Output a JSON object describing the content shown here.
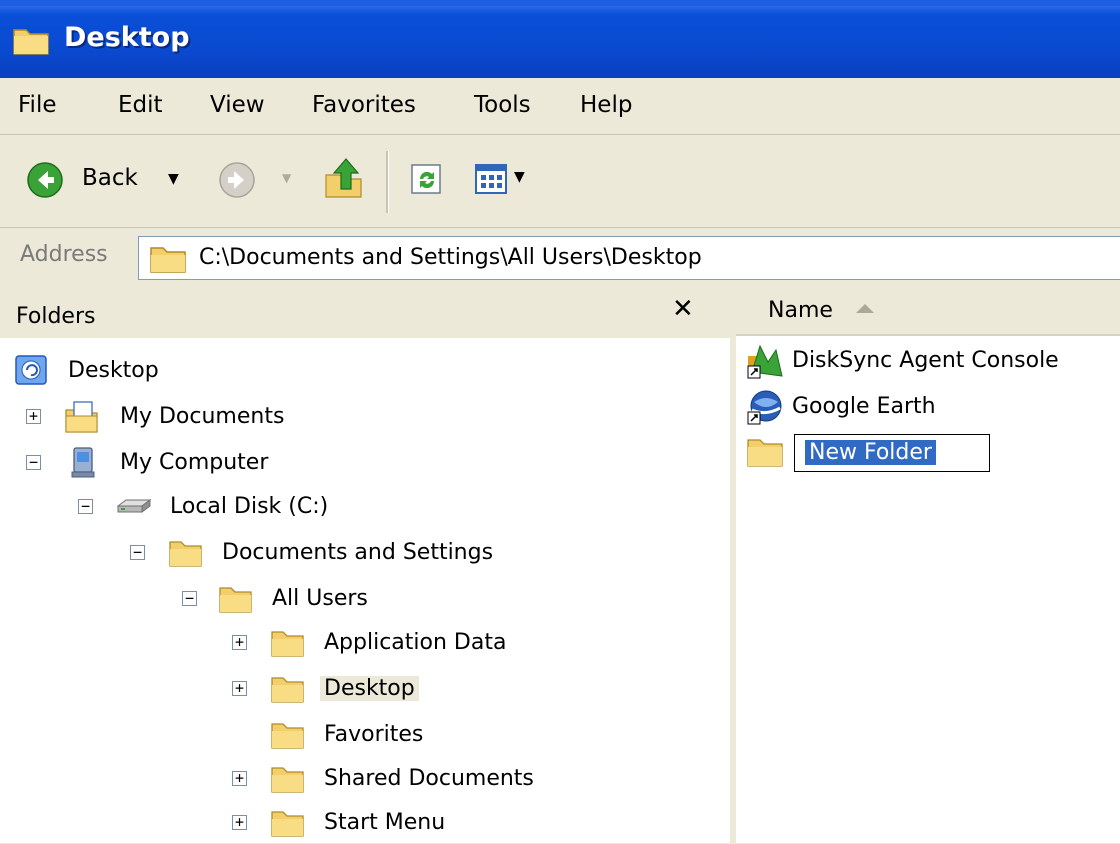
{
  "window": {
    "title": "Desktop"
  },
  "menu": [
    "File",
    "Edit",
    "View",
    "Favorites",
    "Tools",
    "Help"
  ],
  "toolbar": {
    "back_label": "Back",
    "icons": [
      "back-icon",
      "forward-icon",
      "up-folder-icon",
      "sync-icon",
      "views-icon"
    ]
  },
  "address": {
    "label": "Address",
    "value": "C:\\Documents and Settings\\All Users\\Desktop"
  },
  "folders": {
    "title": "Folders",
    "close": "✕",
    "tree": [
      {
        "label": "Desktop",
        "icon": "desktop-icon",
        "expander": ""
      },
      {
        "label": "My Documents",
        "icon": "my-documents-icon",
        "expander": "+"
      },
      {
        "label": "My Computer",
        "icon": "my-computer-icon",
        "expander": "−"
      },
      {
        "label": "Local Disk (C:)",
        "icon": "hard-disk-icon",
        "expander": "−"
      },
      {
        "label": "Documents and Settings",
        "icon": "folder-icon",
        "expander": "−"
      },
      {
        "label": "All Users",
        "icon": "folder-icon",
        "expander": "−"
      },
      {
        "label": "Application Data",
        "icon": "folder-icon",
        "expander": "+"
      },
      {
        "label": "Desktop",
        "icon": "folder-icon",
        "expander": "+",
        "selected": true
      },
      {
        "label": "Favorites",
        "icon": "folder-icon",
        "expander": ""
      },
      {
        "label": "Shared Documents",
        "icon": "folder-icon",
        "expander": "+"
      },
      {
        "label": "Start Menu",
        "icon": "folder-icon",
        "expander": "+"
      }
    ]
  },
  "files": {
    "column_name": "Name",
    "items": [
      {
        "label": "DiskSync Agent Console",
        "icon": "disksync-shortcut-icon"
      },
      {
        "label": "Google Earth",
        "icon": "google-earth-shortcut-icon"
      },
      {
        "label": "New Folder",
        "icon": "folder-icon",
        "renaming": true
      }
    ]
  },
  "colors": {
    "titlebar": "#0a4ad0",
    "selection": "#316ac5",
    "chrome": "#ece9d8"
  }
}
